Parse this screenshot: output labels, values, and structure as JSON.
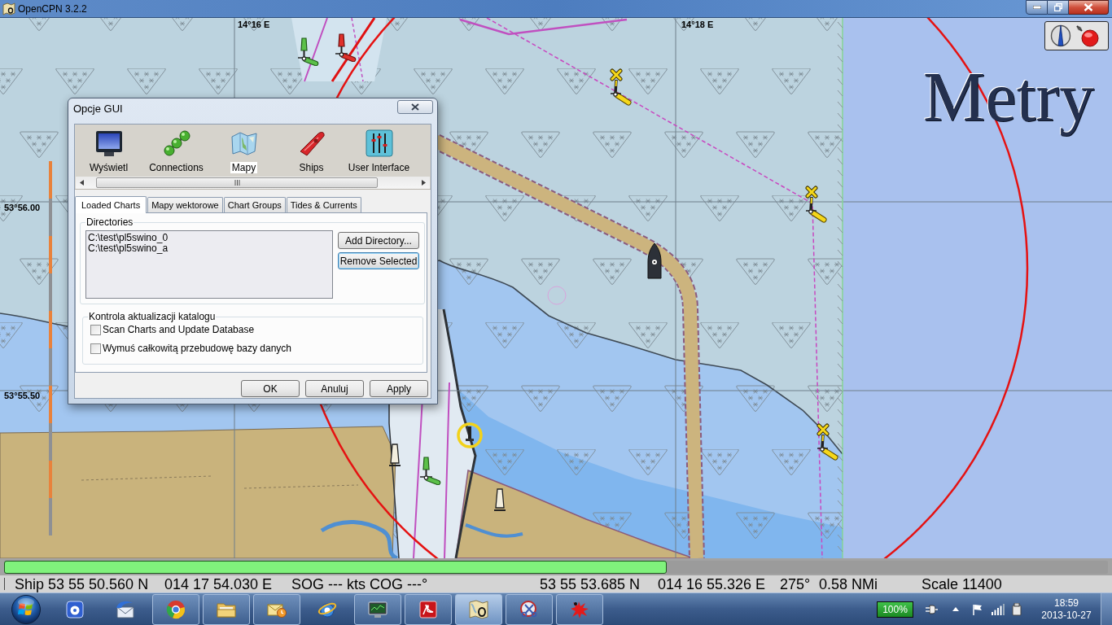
{
  "window": {
    "title": "OpenCPN 3.2.2"
  },
  "chart": {
    "grid_labels": [
      "14°16 E",
      "14°18 E",
      "53°56.00",
      "53°55.50"
    ],
    "units_label": "Metry"
  },
  "dialog": {
    "title": "Opcje GUI",
    "categories": [
      {
        "kind": "display",
        "label": "Wyświetl",
        "selected": false
      },
      {
        "kind": "connections",
        "label": "Connections",
        "selected": false
      },
      {
        "kind": "charts",
        "label": "Mapy",
        "selected": true
      },
      {
        "kind": "ships",
        "label": "Ships",
        "selected": false
      },
      {
        "kind": "interface",
        "label": "User Interface",
        "selected": false
      }
    ],
    "tabs": [
      {
        "label": "Loaded Charts",
        "selected": true
      },
      {
        "label": "Mapy wektorowe",
        "selected": false
      },
      {
        "label": "Chart Groups",
        "selected": false
      },
      {
        "label": "Tides & Currents",
        "selected": false
      }
    ],
    "directories": {
      "label": "Directories",
      "items": [
        {
          "path": "C:\\test\\pl5swino_0",
          "selected": false
        },
        {
          "path": "C:\\test\\pl5swino_a",
          "selected": false
        }
      ],
      "buttons": [
        {
          "label": "Add Directory...",
          "focused": false
        },
        {
          "label": "Remove Selected",
          "focused": true
        }
      ]
    },
    "catalog": {
      "label": "Kontrola aktualizacji katalogu",
      "options": [
        {
          "label": "Scan Charts and Update Database",
          "checked": false
        },
        {
          "label": "Wymuś całkowitą przebudowę bazy danych",
          "checked": false
        }
      ]
    },
    "buttons": [
      "OK",
      "Anuluj",
      "Apply"
    ]
  },
  "chart_bar": {
    "level": 0.6
  },
  "status_bar": {
    "ship_latitude": "Ship 53 55 50.560 N",
    "ship_longitude": "014 17 54.030 E",
    "sog": "SOG --- kts",
    "cog": "COG ---°",
    "cursor_latitude": "53 55 53.685 N",
    "cursor_longitude": "014 16 55.326 E",
    "bearing": "275°",
    "distance": "0.58 NMi",
    "scale": "Scale 11400"
  },
  "taskbar": {
    "apps": [
      {
        "kind": "media",
        "running": false,
        "selected": false
      },
      {
        "kind": "mail",
        "running": false,
        "selected": false
      },
      {
        "kind": "browser",
        "running": true,
        "selected": false
      },
      {
        "kind": "folder",
        "running": true,
        "selected": false
      },
      {
        "kind": "calendar",
        "running": true,
        "selected": false
      },
      {
        "kind": "web",
        "running": false,
        "selected": false
      },
      {
        "kind": "monitor",
        "running": true,
        "selected": false
      },
      {
        "kind": "document",
        "running": true,
        "selected": false
      },
      {
        "kind": "chart",
        "running": true,
        "selected": true
      },
      {
        "kind": "snip",
        "running": true,
        "selected": false
      },
      {
        "kind": "paint",
        "running": true,
        "selected": false
      }
    ],
    "tray": {
      "battery": "100%",
      "time": "18:59",
      "date": "2013-10-27"
    }
  }
}
